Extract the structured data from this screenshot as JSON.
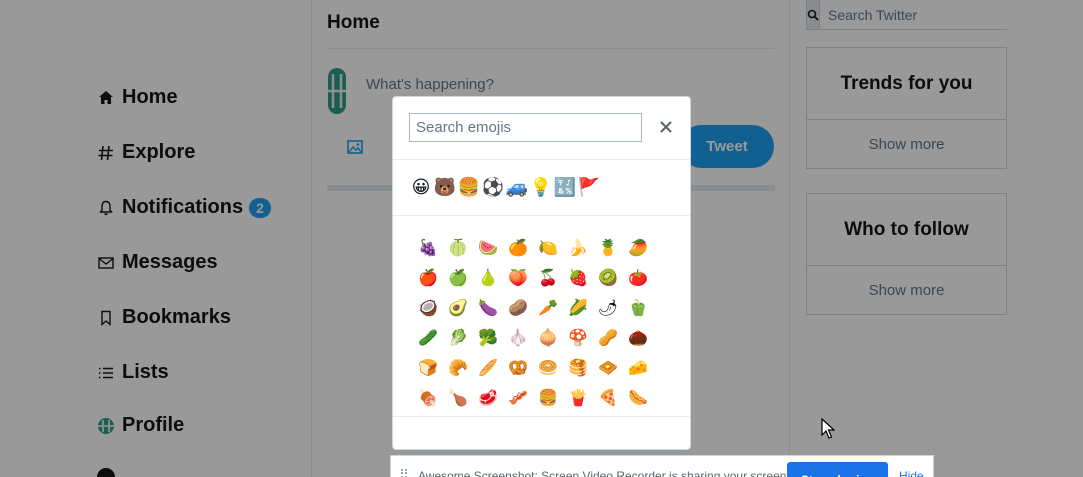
{
  "nav": {
    "items": [
      {
        "label": "Home",
        "icon": "home-icon"
      },
      {
        "label": "Explore",
        "icon": "hash-icon"
      },
      {
        "label": "Notifications",
        "icon": "bell-icon",
        "badge": "2"
      },
      {
        "label": "Messages",
        "icon": "envelope-icon"
      },
      {
        "label": "Bookmarks",
        "icon": "bookmark-icon"
      },
      {
        "label": "Lists",
        "icon": "list-icon"
      },
      {
        "label": "Profile",
        "icon": "avatar-icon"
      }
    ]
  },
  "main": {
    "title": "Home",
    "compose_placeholder": "What's happening?",
    "tweet_label": "Tweet"
  },
  "sidebar": {
    "search_placeholder": "Search Twitter",
    "trends_title": "Trends for you",
    "trends_more": "Show more",
    "follow_title": "Who to follow",
    "follow_more": "Show more"
  },
  "emoji_picker": {
    "search_placeholder": "Search emojis",
    "categories": [
      "😀",
      "🐻",
      "🍔",
      "⚽",
      "🚙",
      "💡",
      "🔣",
      "🚩"
    ],
    "grid": [
      [
        "🍇",
        "🍈",
        "🍉",
        "🍊",
        "🍋",
        "🍌",
        "🍍",
        "🥭"
      ],
      [
        "🍎",
        "🍏",
        "🍐",
        "🍑",
        "🍒",
        "🍓",
        "🥝",
        "🍅"
      ],
      [
        "🥥",
        "🥑",
        "🍆",
        "🥔",
        "🥕",
        "🌽",
        "🌶",
        "🫑"
      ],
      [
        "🥒",
        "🥬",
        "🥦",
        "🧄",
        "🧅",
        "🍄",
        "🥜",
        "🌰"
      ],
      [
        "🍞",
        "🥐",
        "🥖",
        "🥨",
        "🥯",
        "🥞",
        "🧇",
        "🧀"
      ],
      [
        "🍖",
        "🍗",
        "🥩",
        "🥓",
        "🍔",
        "🍟",
        "🍕",
        "🌭"
      ]
    ]
  },
  "share_bar": {
    "text": "Awesome Screenshot: Screen Video Recorder is sharing your screen.",
    "stop_label": "Stop sharing",
    "hide_label": "Hide"
  },
  "colors": {
    "accent": "#1da1f2",
    "share_accent": "#1a73e8"
  }
}
